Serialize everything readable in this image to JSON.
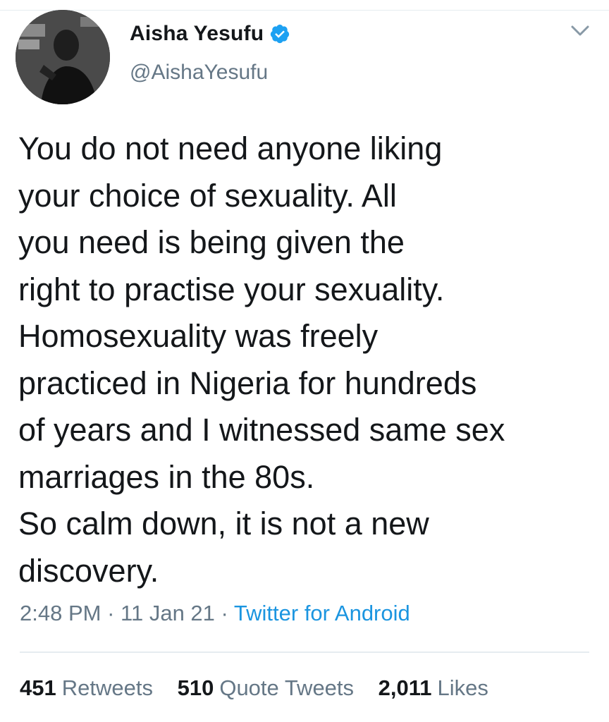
{
  "author": {
    "display_name": "Aisha Yesufu",
    "handle": "@AishaYesufu",
    "verified": true,
    "avatar_icon": "profile-photo"
  },
  "tweet": {
    "text_lines": [
      "You do not need anyone liking",
      "your choice of sexuality. All",
      "you need is being given the",
      "right to practise your sexuality.",
      "Homosexuality was freely",
      "practiced in Nigeria for hundreds",
      "of years and I witnessed same sex",
      "marriages in the 80s.",
      "So calm down, it is not a new",
      "discovery."
    ],
    "time": "2:48 PM",
    "separator": "·",
    "date": "11 Jan 21",
    "source": "Twitter for Android"
  },
  "stats": {
    "retweets": {
      "count": "451",
      "label": "Retweets"
    },
    "quote_tweets": {
      "count": "510",
      "label": "Quote Tweets"
    },
    "likes": {
      "count": "2,011",
      "label": "Likes"
    }
  },
  "colors": {
    "text": "#14171a",
    "secondary": "#657786",
    "accent": "#1b95e0",
    "verified_badge": "#1da1f2",
    "divider": "#e6ecf0"
  }
}
